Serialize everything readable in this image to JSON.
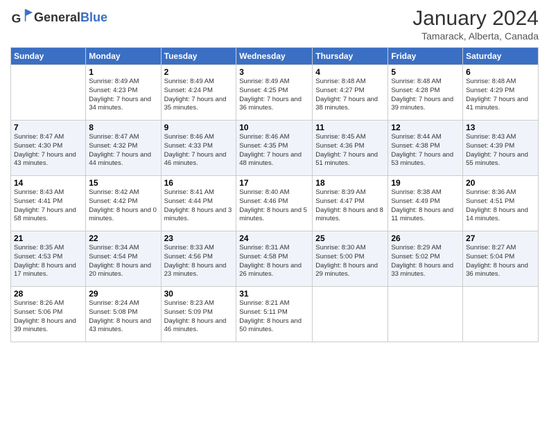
{
  "header": {
    "logo_line1": "General",
    "logo_line2": "Blue",
    "month_title": "January 2024",
    "location": "Tamarack, Alberta, Canada"
  },
  "days_of_week": [
    "Sunday",
    "Monday",
    "Tuesday",
    "Wednesday",
    "Thursday",
    "Friday",
    "Saturday"
  ],
  "weeks": [
    [
      {
        "num": "",
        "sunrise": "",
        "sunset": "",
        "daylight": ""
      },
      {
        "num": "1",
        "sunrise": "Sunrise: 8:49 AM",
        "sunset": "Sunset: 4:23 PM",
        "daylight": "Daylight: 7 hours and 34 minutes."
      },
      {
        "num": "2",
        "sunrise": "Sunrise: 8:49 AM",
        "sunset": "Sunset: 4:24 PM",
        "daylight": "Daylight: 7 hours and 35 minutes."
      },
      {
        "num": "3",
        "sunrise": "Sunrise: 8:49 AM",
        "sunset": "Sunset: 4:25 PM",
        "daylight": "Daylight: 7 hours and 36 minutes."
      },
      {
        "num": "4",
        "sunrise": "Sunrise: 8:48 AM",
        "sunset": "Sunset: 4:27 PM",
        "daylight": "Daylight: 7 hours and 38 minutes."
      },
      {
        "num": "5",
        "sunrise": "Sunrise: 8:48 AM",
        "sunset": "Sunset: 4:28 PM",
        "daylight": "Daylight: 7 hours and 39 minutes."
      },
      {
        "num": "6",
        "sunrise": "Sunrise: 8:48 AM",
        "sunset": "Sunset: 4:29 PM",
        "daylight": "Daylight: 7 hours and 41 minutes."
      }
    ],
    [
      {
        "num": "7",
        "sunrise": "Sunrise: 8:47 AM",
        "sunset": "Sunset: 4:30 PM",
        "daylight": "Daylight: 7 hours and 43 minutes."
      },
      {
        "num": "8",
        "sunrise": "Sunrise: 8:47 AM",
        "sunset": "Sunset: 4:32 PM",
        "daylight": "Daylight: 7 hours and 44 minutes."
      },
      {
        "num": "9",
        "sunrise": "Sunrise: 8:46 AM",
        "sunset": "Sunset: 4:33 PM",
        "daylight": "Daylight: 7 hours and 46 minutes."
      },
      {
        "num": "10",
        "sunrise": "Sunrise: 8:46 AM",
        "sunset": "Sunset: 4:35 PM",
        "daylight": "Daylight: 7 hours and 48 minutes."
      },
      {
        "num": "11",
        "sunrise": "Sunrise: 8:45 AM",
        "sunset": "Sunset: 4:36 PM",
        "daylight": "Daylight: 7 hours and 51 minutes."
      },
      {
        "num": "12",
        "sunrise": "Sunrise: 8:44 AM",
        "sunset": "Sunset: 4:38 PM",
        "daylight": "Daylight: 7 hours and 53 minutes."
      },
      {
        "num": "13",
        "sunrise": "Sunrise: 8:43 AM",
        "sunset": "Sunset: 4:39 PM",
        "daylight": "Daylight: 7 hours and 55 minutes."
      }
    ],
    [
      {
        "num": "14",
        "sunrise": "Sunrise: 8:43 AM",
        "sunset": "Sunset: 4:41 PM",
        "daylight": "Daylight: 7 hours and 58 minutes."
      },
      {
        "num": "15",
        "sunrise": "Sunrise: 8:42 AM",
        "sunset": "Sunset: 4:42 PM",
        "daylight": "Daylight: 8 hours and 0 minutes."
      },
      {
        "num": "16",
        "sunrise": "Sunrise: 8:41 AM",
        "sunset": "Sunset: 4:44 PM",
        "daylight": "Daylight: 8 hours and 3 minutes."
      },
      {
        "num": "17",
        "sunrise": "Sunrise: 8:40 AM",
        "sunset": "Sunset: 4:46 PM",
        "daylight": "Daylight: 8 hours and 5 minutes."
      },
      {
        "num": "18",
        "sunrise": "Sunrise: 8:39 AM",
        "sunset": "Sunset: 4:47 PM",
        "daylight": "Daylight: 8 hours and 8 minutes."
      },
      {
        "num": "19",
        "sunrise": "Sunrise: 8:38 AM",
        "sunset": "Sunset: 4:49 PM",
        "daylight": "Daylight: 8 hours and 11 minutes."
      },
      {
        "num": "20",
        "sunrise": "Sunrise: 8:36 AM",
        "sunset": "Sunset: 4:51 PM",
        "daylight": "Daylight: 8 hours and 14 minutes."
      }
    ],
    [
      {
        "num": "21",
        "sunrise": "Sunrise: 8:35 AM",
        "sunset": "Sunset: 4:53 PM",
        "daylight": "Daylight: 8 hours and 17 minutes."
      },
      {
        "num": "22",
        "sunrise": "Sunrise: 8:34 AM",
        "sunset": "Sunset: 4:54 PM",
        "daylight": "Daylight: 8 hours and 20 minutes."
      },
      {
        "num": "23",
        "sunrise": "Sunrise: 8:33 AM",
        "sunset": "Sunset: 4:56 PM",
        "daylight": "Daylight: 8 hours and 23 minutes."
      },
      {
        "num": "24",
        "sunrise": "Sunrise: 8:31 AM",
        "sunset": "Sunset: 4:58 PM",
        "daylight": "Daylight: 8 hours and 26 minutes."
      },
      {
        "num": "25",
        "sunrise": "Sunrise: 8:30 AM",
        "sunset": "Sunset: 5:00 PM",
        "daylight": "Daylight: 8 hours and 29 minutes."
      },
      {
        "num": "26",
        "sunrise": "Sunrise: 8:29 AM",
        "sunset": "Sunset: 5:02 PM",
        "daylight": "Daylight: 8 hours and 33 minutes."
      },
      {
        "num": "27",
        "sunrise": "Sunrise: 8:27 AM",
        "sunset": "Sunset: 5:04 PM",
        "daylight": "Daylight: 8 hours and 36 minutes."
      }
    ],
    [
      {
        "num": "28",
        "sunrise": "Sunrise: 8:26 AM",
        "sunset": "Sunset: 5:06 PM",
        "daylight": "Daylight: 8 hours and 39 minutes."
      },
      {
        "num": "29",
        "sunrise": "Sunrise: 8:24 AM",
        "sunset": "Sunset: 5:08 PM",
        "daylight": "Daylight: 8 hours and 43 minutes."
      },
      {
        "num": "30",
        "sunrise": "Sunrise: 8:23 AM",
        "sunset": "Sunset: 5:09 PM",
        "daylight": "Daylight: 8 hours and 46 minutes."
      },
      {
        "num": "31",
        "sunrise": "Sunrise: 8:21 AM",
        "sunset": "Sunset: 5:11 PM",
        "daylight": "Daylight: 8 hours and 50 minutes."
      },
      {
        "num": "",
        "sunrise": "",
        "sunset": "",
        "daylight": ""
      },
      {
        "num": "",
        "sunrise": "",
        "sunset": "",
        "daylight": ""
      },
      {
        "num": "",
        "sunrise": "",
        "sunset": "",
        "daylight": ""
      }
    ]
  ]
}
